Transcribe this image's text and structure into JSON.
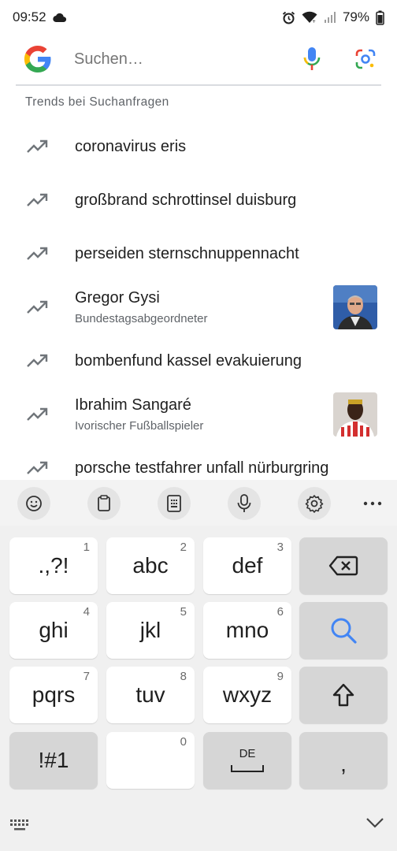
{
  "status_bar": {
    "time": "09:52",
    "battery": "79%",
    "icons": [
      "cloud-icon",
      "alarm-icon",
      "wifi-icon",
      "signal-icon",
      "battery-icon"
    ]
  },
  "search": {
    "placeholder": "Suchen…",
    "icons": [
      "google-logo-icon",
      "microphone-icon",
      "lens-camera-icon"
    ]
  },
  "trends": {
    "heading": "Trends bei Suchanfragen",
    "items": [
      {
        "title": "coronavirus eris",
        "subtitle": "",
        "thumbnail": false
      },
      {
        "title": "großbrand schrottinsel duisburg",
        "subtitle": "",
        "thumbnail": false
      },
      {
        "title": "perseiden sternschnuppennacht",
        "subtitle": "",
        "thumbnail": false
      },
      {
        "title": "Gregor Gysi",
        "subtitle": "Bundestagsabgeordneter",
        "thumbnail": true
      },
      {
        "title": "bombenfund kassel evakuierung",
        "subtitle": "",
        "thumbnail": false
      },
      {
        "title": "Ibrahim Sangaré",
        "subtitle": "Ivorischer Fußballspieler",
        "thumbnail": true
      },
      {
        "title": "porsche testfahrer unfall nürburgring",
        "subtitle": "",
        "thumbnail": false
      }
    ]
  },
  "keyboard_toolbar": {
    "icons": [
      "emoji-icon",
      "clipboard-icon",
      "keypad-icon",
      "voice-input-icon",
      "settings-icon",
      "more-icon"
    ]
  },
  "keyboard": {
    "keys": [
      {
        "label": ".,?!",
        "num": "1"
      },
      {
        "label": "abc",
        "num": "2"
      },
      {
        "label": "def",
        "num": "3"
      },
      {
        "label": "ghi",
        "num": "4"
      },
      {
        "label": "jkl",
        "num": "5"
      },
      {
        "label": "mno",
        "num": "6"
      },
      {
        "label": "pqrs",
        "num": "7"
      },
      {
        "label": "tuv",
        "num": "8"
      },
      {
        "label": "wxyz",
        "num": "9"
      },
      {
        "label": "!#1",
        "num": ""
      },
      {
        "label": "",
        "num": "0"
      },
      {
        "label": ",",
        "num": ""
      }
    ],
    "language": "DE",
    "func_icons": [
      "backspace-icon",
      "search-key-icon",
      "shift-icon"
    ]
  },
  "colors": {
    "accent_blue": "#4285f4",
    "google_red": "#ea4335",
    "google_yellow": "#fbbc05",
    "google_green": "#34a853"
  }
}
